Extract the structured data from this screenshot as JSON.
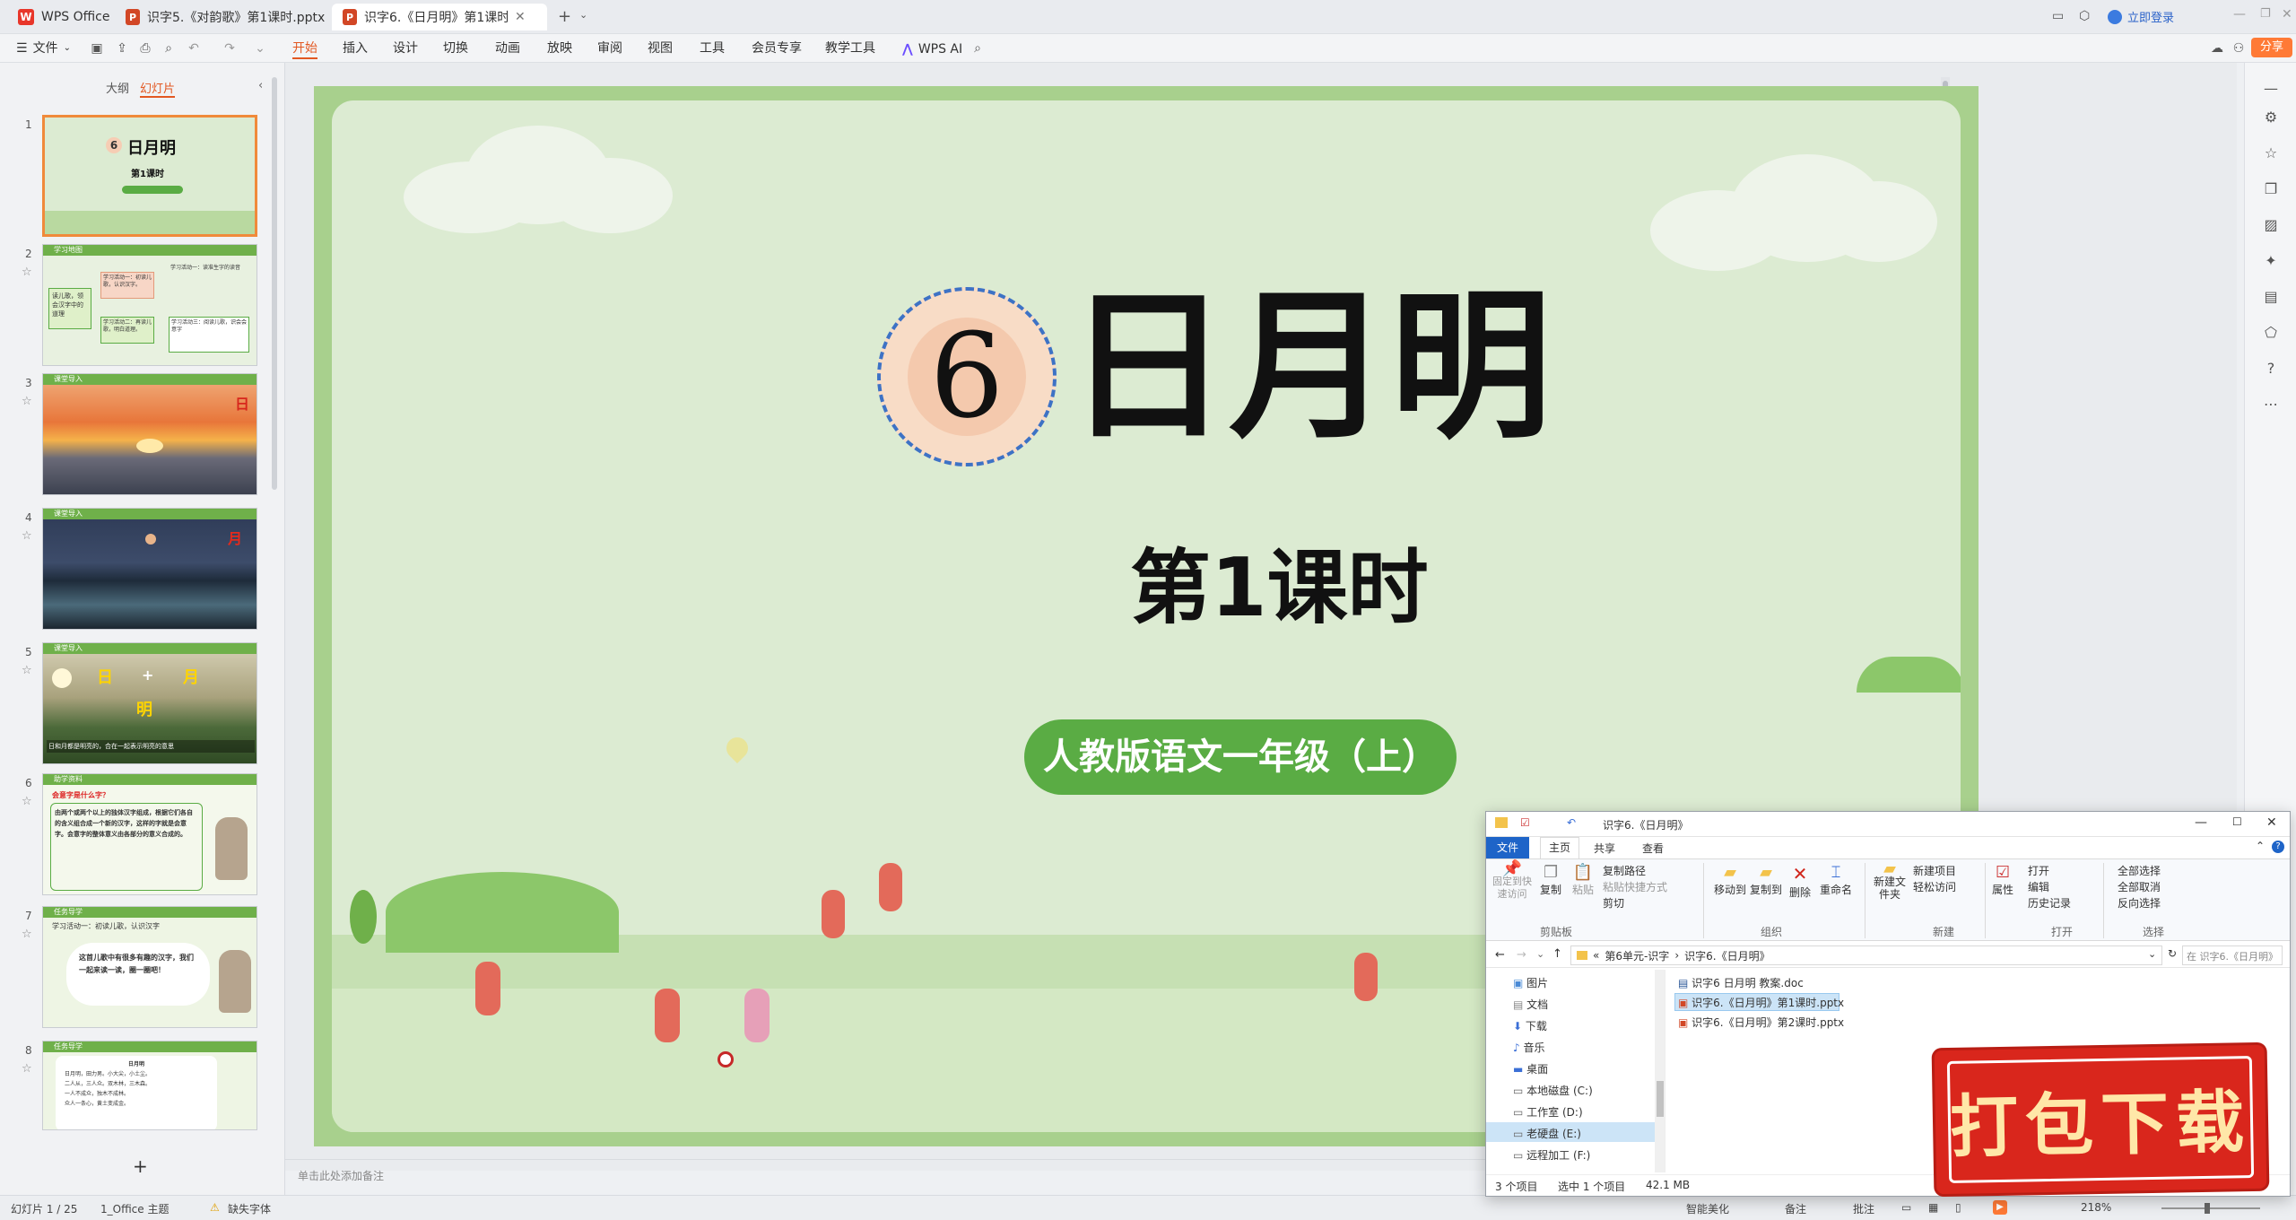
{
  "titlebar": {
    "app_name": "WPS Office",
    "tabs": [
      {
        "label": "识字5.《对韵歌》第1课时.pptx"
      },
      {
        "label": "识字6.《日月明》第1课时.pptx"
      }
    ],
    "login": "立即登录",
    "add_tab": "+"
  },
  "menubar": {
    "file": "文件",
    "items": [
      "开始",
      "插入",
      "设计",
      "切换",
      "动画",
      "放映",
      "审阅",
      "视图",
      "工具",
      "会员专享",
      "教学工具"
    ],
    "wps_ai": "WPS AI",
    "share": "分享"
  },
  "leftpanel": {
    "tab_outline": "大纲",
    "tab_slides": "幻灯片",
    "add": "+",
    "thumbs": [
      {
        "num": "1",
        "title": "日月明",
        "sub": "第1课时",
        "badge": "6"
      },
      {
        "num": "2",
        "strip": "学习地图",
        "center": "读儿歌，领会汉字中的道理",
        "b1": "学习活动一：初读儿歌，认识汉字。",
        "b2": "学习活动二：再读儿歌，明白道理。",
        "b3": "学习活动一：读准生字的读音",
        "b4": "学习活动三：阅读儿歌，识会会意字"
      },
      {
        "num": "3",
        "strip": "课堂导入",
        "char": "日"
      },
      {
        "num": "4",
        "strip": "课堂导入",
        "char": "月"
      },
      {
        "num": "5",
        "strip": "课堂导入",
        "c1": "日",
        "plus": "+",
        "c2": "月",
        "c3": "明",
        "caption": "日和月都是明亮的，合在一起表示明亮的意思"
      },
      {
        "num": "6",
        "strip": "助学资料",
        "q": "会意字是什么字？",
        "body": "由两个或两个以上的独体汉字组成，根据它们各自的含义组合成一个新的汉字，这样的字就是会意字。会意字的整体意义由各部分的意义合成的。"
      },
      {
        "num": "7",
        "strip": "任务导学",
        "activity": "学习活动一：初读儿歌，认识汉字",
        "bubble": "这首儿歌中有很多有趣的汉字，我们一起来读一读，圈一圈吧！"
      },
      {
        "num": "8",
        "strip": "任务导学",
        "poem_title": "日月明",
        "lines": [
          "日月明，田力男。小大尖，小土尘。",
          "二人从，三人众。双木林，三木森。",
          "一人不成众，独木不成林。",
          "众人一条心，黄土变成金。"
        ]
      }
    ]
  },
  "slide": {
    "number": "6",
    "title": "日月明",
    "subtitle": "第1课时",
    "pill": "人教版语文一年级（上）"
  },
  "notes_placeholder": "单击此处添加备注",
  "statusbar": {
    "slide_count": "幻灯片 1 / 25",
    "theme": "1_Office 主题",
    "missing_font": "缺失字体",
    "smart": "智能美化",
    "notes": "备注",
    "comments": "批注",
    "zoom": "218%"
  },
  "explorer": {
    "title": "识字6.《日月明》",
    "ribbon_tabs": [
      "文件",
      "主页",
      "共享",
      "查看"
    ],
    "groups": {
      "clipboard": "剪贴板",
      "organize": "组织",
      "new": "新建",
      "open": "打开",
      "select": "选择"
    },
    "buttons": {
      "pin": "固定到快速访问",
      "copy": "复制",
      "paste": "粘贴",
      "copy_path": "复制路径",
      "paste_shortcut": "粘贴快捷方式",
      "cut": "剪切",
      "move_to": "移动到",
      "copy_to": "复制到",
      "delete": "删除",
      "rename": "重命名",
      "new_folder": "新建文件夹",
      "new_item": "新建项目",
      "easy_access": "轻松访问",
      "properties": "属性",
      "open": "打开",
      "edit": "编辑",
      "history": "历史记录",
      "select_all": "全部选择",
      "select_none": "全部取消",
      "invert": "反向选择"
    },
    "breadcrumb": [
      "第6单元-识字",
      "识字6.《日月明》"
    ],
    "search_placeholder": "在 识字6.《日月明》 中搜索",
    "nav": [
      "图片",
      "文档",
      "下载",
      "音乐",
      "桌面",
      "本地磁盘 (C:)",
      "工作室 (D:)",
      "老硬盘 (E:)",
      "远程加工 (F:)"
    ],
    "files": [
      {
        "name": "识字6 日月明 教案.doc",
        "type": "doc"
      },
      {
        "name": "识字6.《日月明》第1课时.pptx",
        "type": "ppt"
      },
      {
        "name": "识字6.《日月明》第2课时.pptx",
        "type": "ppt"
      }
    ],
    "status": {
      "items": "3 个项目",
      "selected": "选中 1 个项目",
      "size": "42.1 MB"
    }
  },
  "stamp": {
    "text": "打包下载"
  },
  "colors": {
    "accent": "#e25822",
    "slide_frame": "#a8d08d",
    "pill": "#5aac44",
    "stamp": "#d9261c"
  }
}
